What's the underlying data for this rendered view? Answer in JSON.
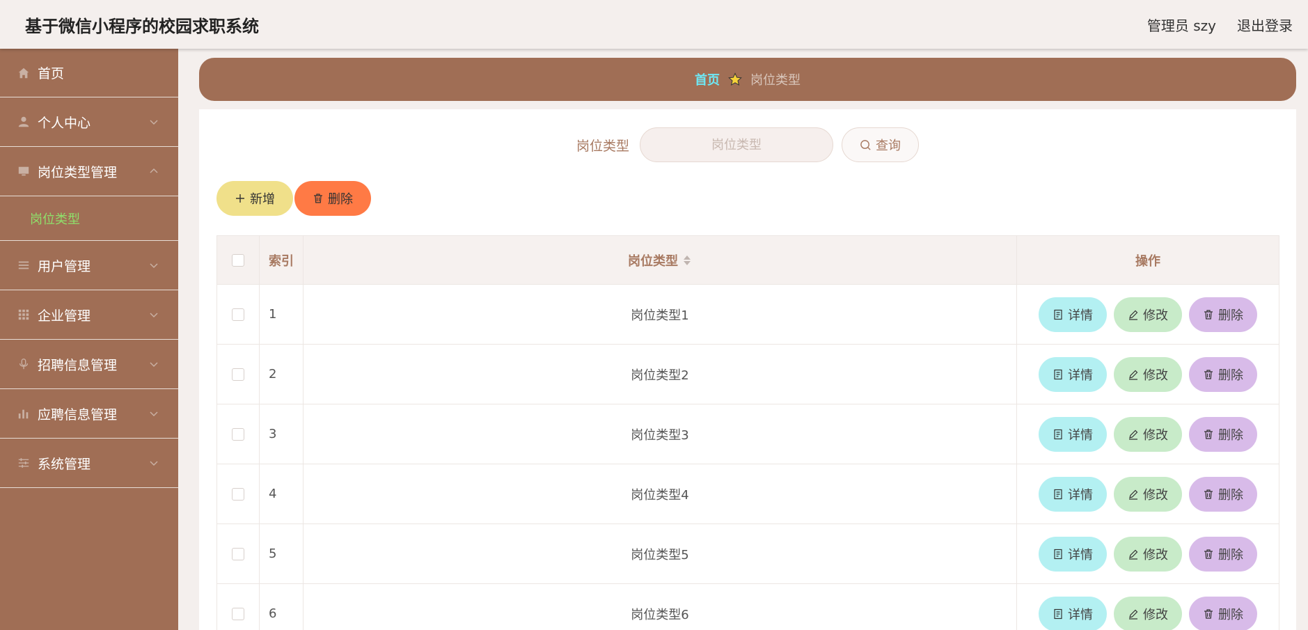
{
  "header": {
    "title": "基于微信小程序的校园求职系统",
    "user_label": "管理员 szy",
    "logout_label": "退出登录"
  },
  "sidebar": {
    "items": [
      {
        "label": "首页",
        "icon": "home-icon"
      },
      {
        "label": "个人中心",
        "icon": "user-icon"
      },
      {
        "label": "岗位类型管理",
        "icon": "monitor-icon",
        "expanded": true,
        "children": [
          "岗位类型"
        ]
      },
      {
        "label": "用户管理",
        "icon": "list-icon"
      },
      {
        "label": "企业管理",
        "icon": "grid-icon"
      },
      {
        "label": "招聘信息管理",
        "icon": "microphone-icon"
      },
      {
        "label": "应聘信息管理",
        "icon": "bar-chart-icon"
      },
      {
        "label": "系统管理",
        "icon": "sliders-icon"
      }
    ]
  },
  "breadcrumb": {
    "home": "首页",
    "current": "岗位类型"
  },
  "search": {
    "label": "岗位类型",
    "placeholder": "岗位类型",
    "button": "查询"
  },
  "actions": {
    "add": "新增",
    "delete": "删除"
  },
  "table": {
    "columns": {
      "index": "索引",
      "type": "岗位类型",
      "ops": "操作"
    },
    "op_labels": {
      "detail": "详情",
      "edit": "修改",
      "delete": "删除"
    },
    "rows": [
      {
        "index": "1",
        "type": "岗位类型1"
      },
      {
        "index": "2",
        "type": "岗位类型2"
      },
      {
        "index": "3",
        "type": "岗位类型3"
      },
      {
        "index": "4",
        "type": "岗位类型4"
      },
      {
        "index": "5",
        "type": "岗位类型5"
      },
      {
        "index": "6",
        "type": "岗位类型6"
      }
    ]
  },
  "colors": {
    "brand": "#a06e55",
    "active_submenu": "#8fe06b",
    "crumb_home": "#6ee8f5"
  }
}
